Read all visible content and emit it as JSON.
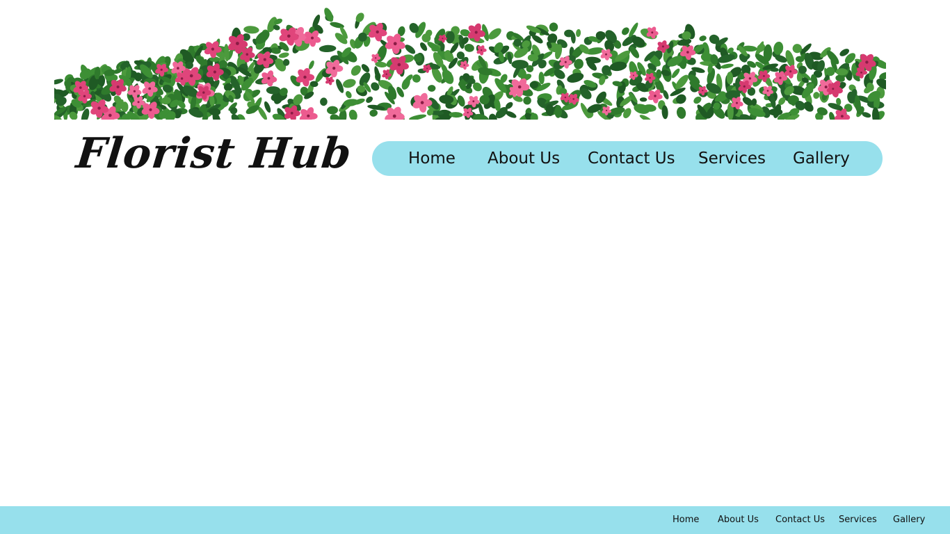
{
  "header": {
    "banner_image": "pink-periwinkle-flower-bush",
    "logo_text": "Florist Hub"
  },
  "nav": {
    "items": [
      "Home",
      "About Us",
      "Contact Us",
      "Services",
      "Gallery"
    ]
  },
  "footer": {
    "items": [
      "Home",
      "About Us",
      "Contact Us",
      "Services",
      "Gallery"
    ]
  },
  "colors": {
    "accent": "#97e0ec",
    "text": "#111111",
    "flower": "#e0457b",
    "leaf": "#2f7a2c"
  }
}
